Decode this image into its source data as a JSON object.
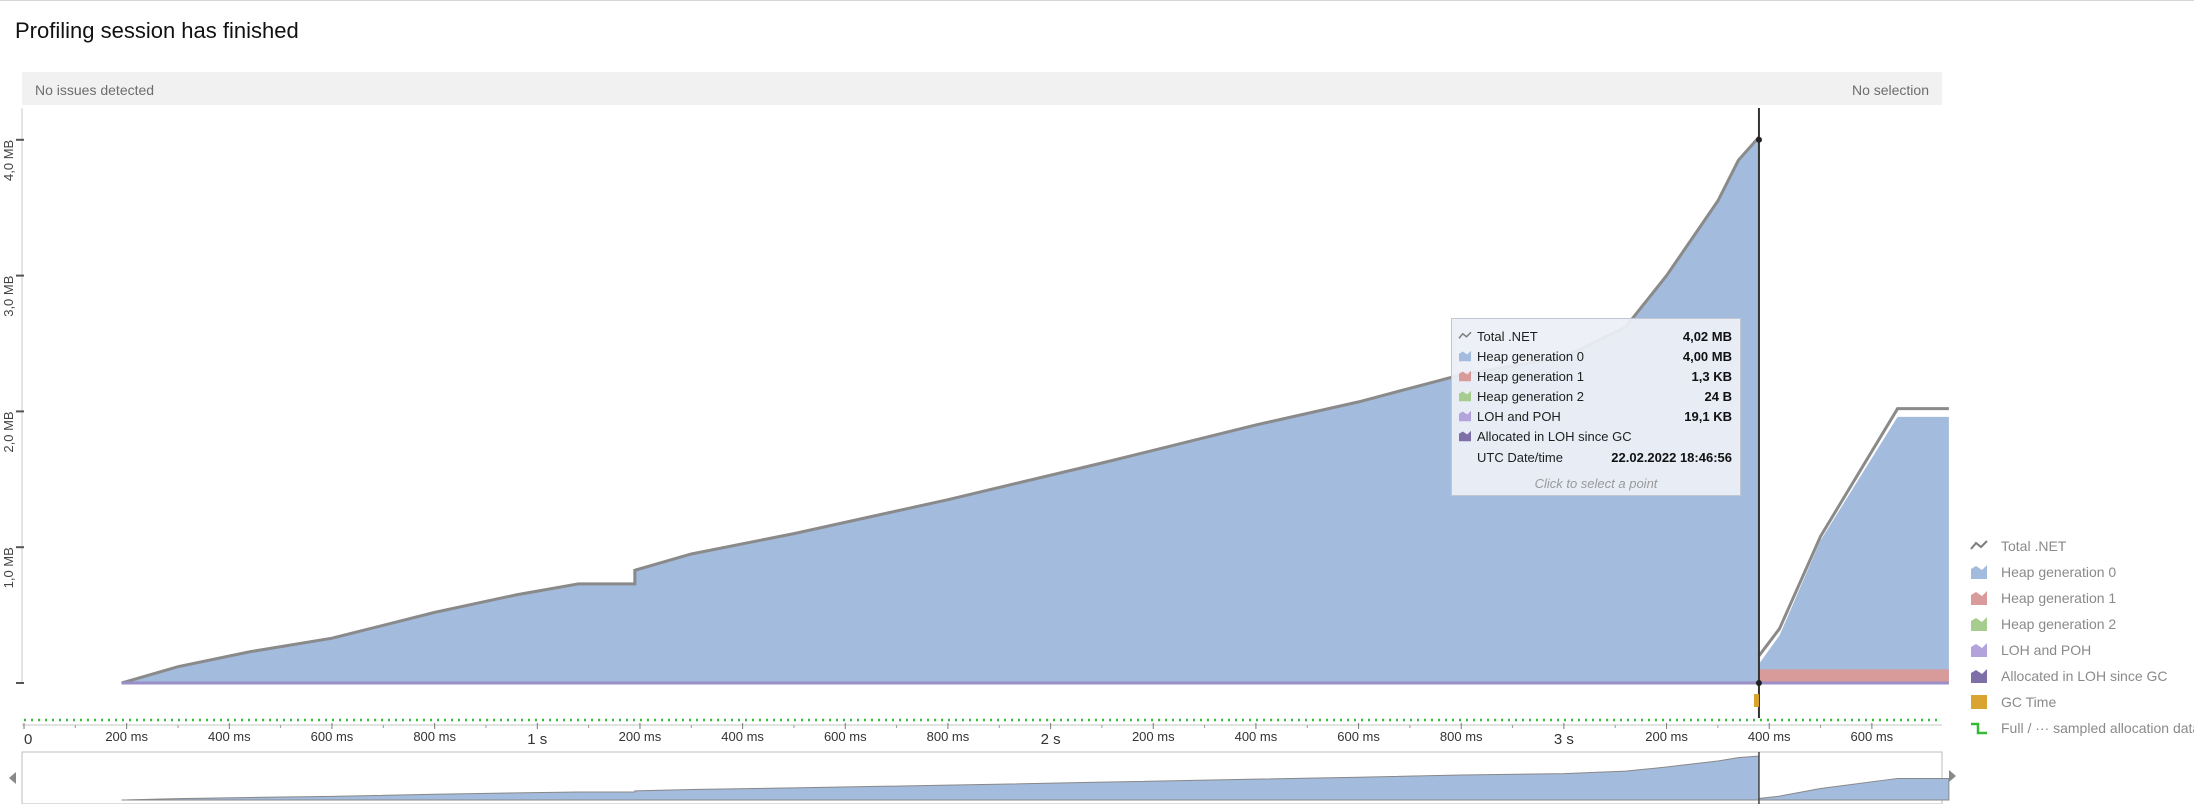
{
  "header": {
    "title": "Profiling session has finished"
  },
  "status": {
    "left": "No issues detected",
    "right": "No selection"
  },
  "chart_data": {
    "type": "area",
    "y_unit": "MB",
    "y_ticks": [
      "1,0 MB",
      "2,0 MB",
      "3,0 MB",
      "4,0 MB"
    ],
    "x_ticks": [
      "0",
      "200 ms",
      "400 ms",
      "600 ms",
      "800 ms",
      "1 s",
      "200 ms",
      "400 ms",
      "600 ms",
      "800 ms",
      "2 s",
      "200 ms",
      "400 ms",
      "600 ms",
      "800 ms",
      "3 s",
      "200 ms",
      "400 ms",
      "600 ms"
    ],
    "xlim_ms": [
      0,
      3750
    ],
    "ylim_mb": [
      0,
      4.2
    ],
    "series": [
      {
        "name": "Heap generation 0",
        "color": "#a3bbdc",
        "x_ms": [
          190,
          300,
          440,
          600,
          800,
          960,
          1080,
          1190,
          1190,
          1300,
          1500,
          1800,
          2100,
          2400,
          2600,
          2800,
          3000,
          3120,
          3200,
          3300,
          3340,
          3380,
          3380,
          3420,
          3500,
          3650,
          3750
        ],
        "y_mb": [
          0,
          0.12,
          0.23,
          0.33,
          0.52,
          0.65,
          0.73,
          0.73,
          0.83,
          0.95,
          1.1,
          1.35,
          1.62,
          1.9,
          2.07,
          2.27,
          2.4,
          2.62,
          3.0,
          3.55,
          3.85,
          4.0,
          0.14,
          0.35,
          1.05,
          1.96,
          1.96
        ]
      },
      {
        "name": "Heap generation 1",
        "color": "#d99a9a",
        "x_ms": [
          3380,
          3750
        ],
        "y_mb": [
          0.1,
          0.1
        ]
      },
      {
        "name": "Total .NET",
        "color": "#8a8a8a",
        "x_ms": [
          190,
          300,
          440,
          600,
          800,
          960,
          1080,
          1190,
          1190,
          1300,
          1500,
          1800,
          2100,
          2400,
          2600,
          2800,
          3000,
          3120,
          3200,
          3300,
          3340,
          3380,
          3380,
          3420,
          3500,
          3650,
          3750
        ],
        "y_mb": [
          0,
          0.12,
          0.23,
          0.33,
          0.52,
          0.65,
          0.73,
          0.73,
          0.83,
          0.95,
          1.1,
          1.35,
          1.62,
          1.9,
          2.07,
          2.27,
          2.4,
          2.62,
          3.0,
          3.55,
          3.85,
          4.02,
          0.2,
          0.4,
          1.08,
          2.02,
          2.02
        ]
      }
    ],
    "cursor_ms": 3380,
    "gc_marker_ms": 3380,
    "grid": false,
    "legend_position": "right"
  },
  "tooltip": {
    "rows": [
      {
        "label": "Total .NET",
        "value": "4,02 MB",
        "icon": "total-net-line-icon",
        "color": "#7d7d7d"
      },
      {
        "label": "Heap generation 0",
        "value": "4,00 MB",
        "icon": "heap-gen0-icon",
        "color": "#a3bbdc"
      },
      {
        "label": "Heap generation 1",
        "value": "1,3 KB",
        "icon": "heap-gen1-icon",
        "color": "#d99a9a"
      },
      {
        "label": "Heap generation 2",
        "value": "24 B",
        "icon": "heap-gen2-icon",
        "color": "#a6cc8f"
      },
      {
        "label": "LOH and POH",
        "value": "19,1 KB",
        "icon": "loh-poh-icon",
        "color": "#b3a3dc"
      },
      {
        "label": "Allocated in LOH since GC",
        "value": "",
        "icon": "loh-allocated-icon",
        "color": "#7f6fa8"
      }
    ],
    "date_label": "UTC Date/time",
    "date_value": "22.02.2022 18:46:56",
    "hint": "Click to select a point"
  },
  "legend": {
    "items": [
      {
        "label": "Total .NET",
        "icon": "total-net-line-icon",
        "color": "#7d7d7d"
      },
      {
        "label": "Heap generation 0",
        "icon": "heap-gen0-icon",
        "color": "#a3bbdc"
      },
      {
        "label": "Heap generation 1",
        "icon": "heap-gen1-icon",
        "color": "#d99a9a"
      },
      {
        "label": "Heap generation 2",
        "icon": "heap-gen2-icon",
        "color": "#a6cc8f"
      },
      {
        "label": "LOH and POH",
        "icon": "loh-poh-icon",
        "color": "#b3a3dc"
      },
      {
        "label": "Allocated in LOH since GC",
        "icon": "loh-allocated-icon",
        "color": "#7f6fa8"
      },
      {
        "label": "GC Time",
        "icon": "gc-time-icon",
        "color": "#d9a530"
      },
      {
        "label": "Full / ··· sampled allocation data",
        "icon": "allocation-data-icon",
        "color": "#33bb33"
      }
    ]
  }
}
